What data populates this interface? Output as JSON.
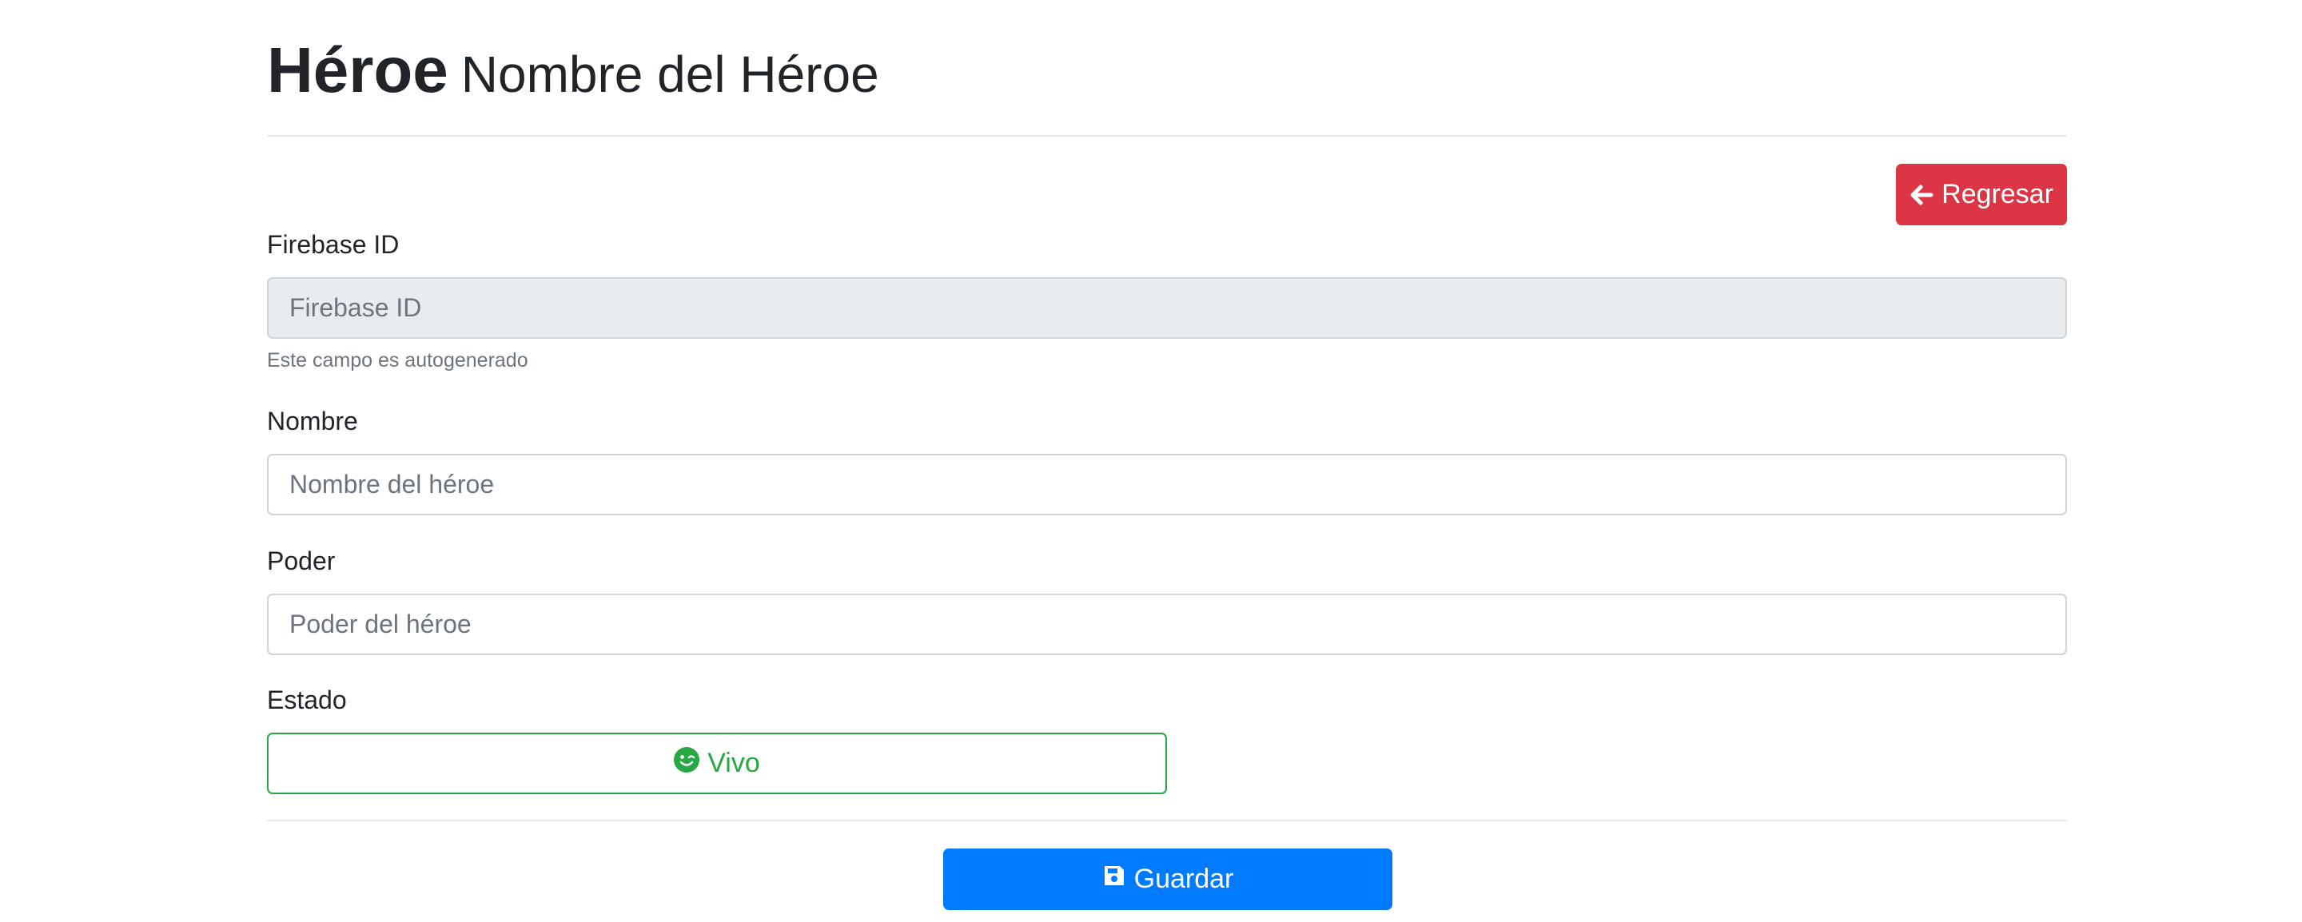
{
  "header": {
    "title": "Héroe",
    "subtitle": "Nombre del Héroe"
  },
  "toolbar": {
    "back_label": "Regresar",
    "back_icon": "arrow-left-icon"
  },
  "form": {
    "firebase_id": {
      "label": "Firebase ID",
      "placeholder": "Firebase ID",
      "value": "",
      "help": "Este campo es autogenerado"
    },
    "nombre": {
      "label": "Nombre",
      "placeholder": "Nombre del héroe",
      "value": ""
    },
    "poder": {
      "label": "Poder",
      "placeholder": "Poder del héroe",
      "value": ""
    },
    "estado": {
      "label": "Estado",
      "button_label": "Vivo",
      "icon": "smile-wink-icon",
      "color": "#28a745"
    },
    "save": {
      "label": "Guardar",
      "icon": "save-icon",
      "color": "#007bff"
    }
  },
  "colors": {
    "back_button": "#dc3545",
    "status_button": "#28a745",
    "save_button": "#007bff"
  }
}
